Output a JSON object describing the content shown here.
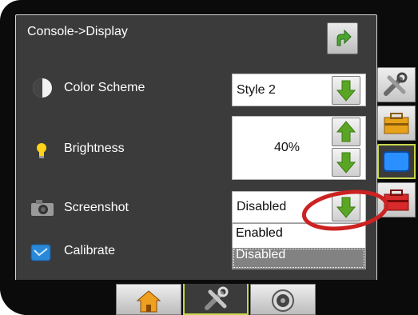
{
  "screen": {
    "breadcrumb": "Console->Display",
    "back_icon": "return-arrow-icon"
  },
  "settings": {
    "color_scheme": {
      "label": "Color Scheme",
      "value": "Style 2",
      "icon": "half-circle-icon"
    },
    "brightness": {
      "label": "Brightness",
      "value": "40%",
      "icon": "light-bulb-icon"
    },
    "screenshot": {
      "label": "Screenshot",
      "value": "Disabled",
      "icon": "camera-icon"
    },
    "calibrate": {
      "label": "Calibrate",
      "icon": "calibrate-icon"
    }
  },
  "dropdown": {
    "options": [
      "Enabled",
      "Disabled"
    ],
    "selected": "Disabled"
  },
  "side_tabs": [
    "tools-icon",
    "toolbox-icon",
    "display-icon",
    "red-toolbox-icon"
  ],
  "bottom_tabs": [
    "home-icon",
    "tools-icon",
    "camera-lens-icon"
  ],
  "colors": {
    "panel": "#3b3b3b",
    "accent": "#c8d64a",
    "arrow_green": "#5aa624",
    "annotation": "#cc2222"
  }
}
